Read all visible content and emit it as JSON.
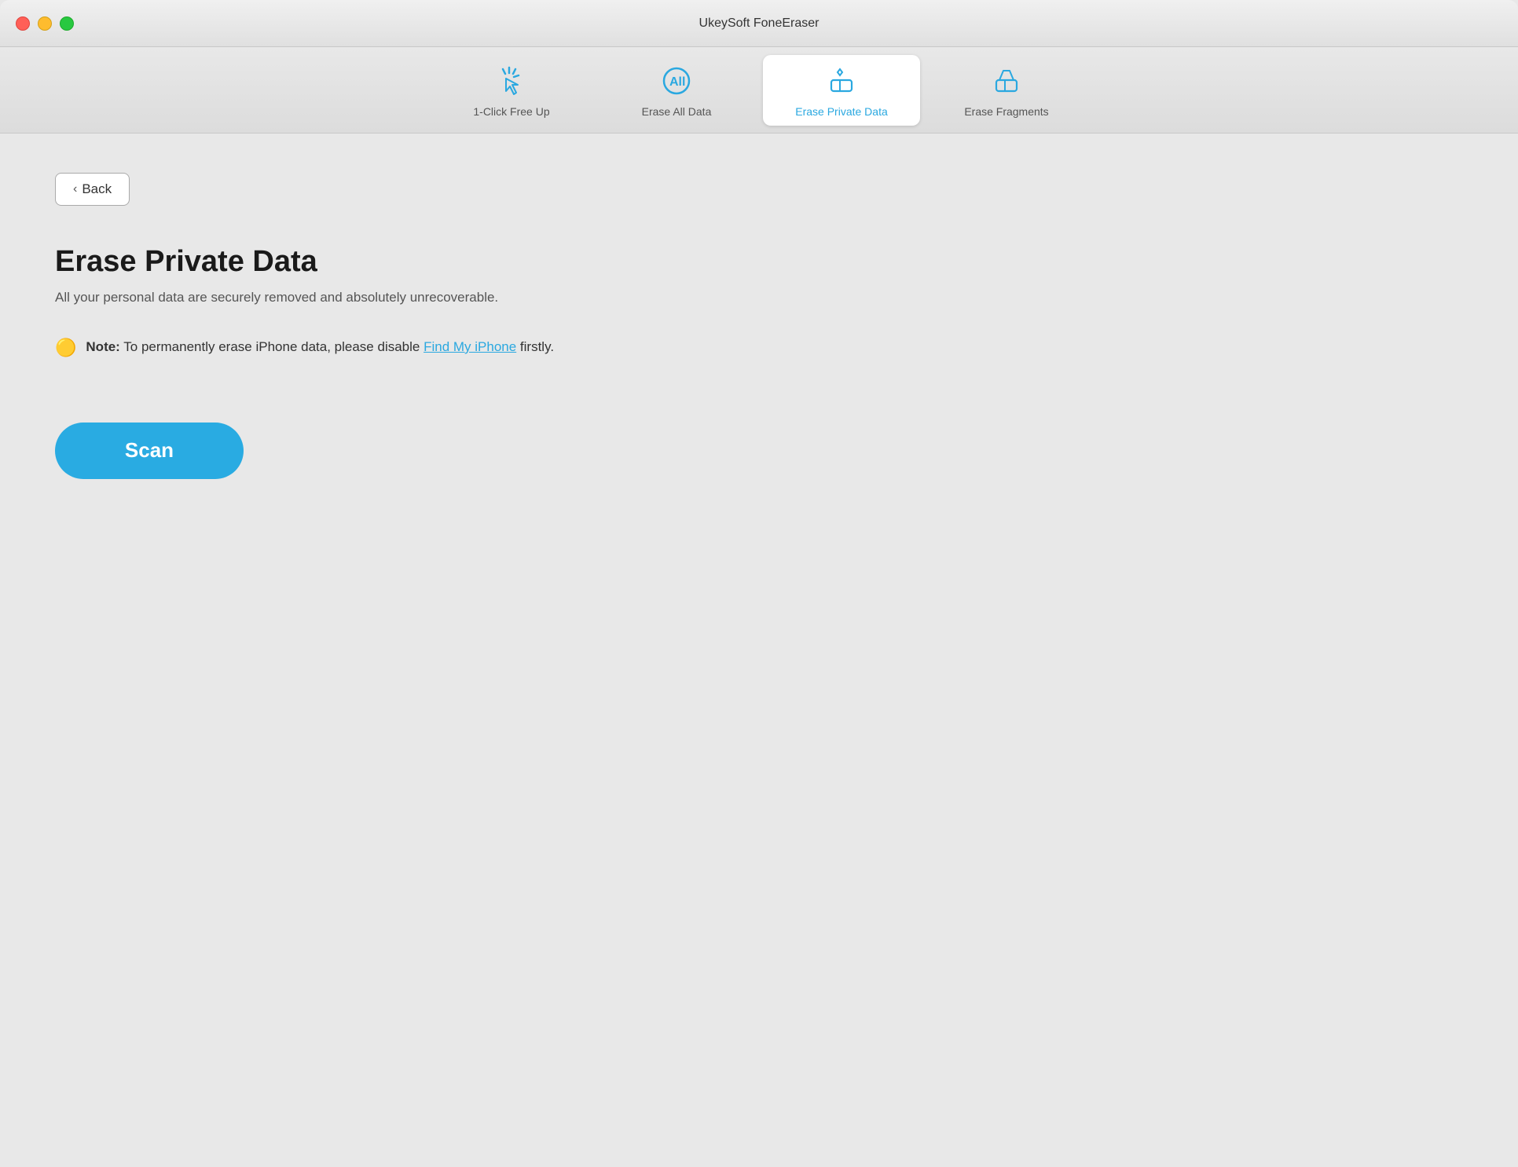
{
  "window": {
    "title": "UkeySoft FoneEraser"
  },
  "traffic_lights": {
    "close_label": "close",
    "minimize_label": "minimize",
    "maximize_label": "maximize"
  },
  "tabs": [
    {
      "id": "one-click",
      "label": "1-Click Free Up",
      "active": false
    },
    {
      "id": "erase-all",
      "label": "Erase All Data",
      "active": false
    },
    {
      "id": "erase-private",
      "label": "Erase Private Data",
      "active": true
    },
    {
      "id": "erase-fragments",
      "label": "Erase Fragments",
      "active": false
    }
  ],
  "back_button": {
    "label": "Back"
  },
  "main": {
    "page_title": "Erase Private Data",
    "page_subtitle": "All your personal data are securely removed and absolutely unrecoverable.",
    "note_label": "Note:",
    "note_text": " To permanently erase iPhone data, please disable ",
    "note_link": "Find My iPhone",
    "note_suffix": " firstly.",
    "scan_button_label": "Scan"
  }
}
